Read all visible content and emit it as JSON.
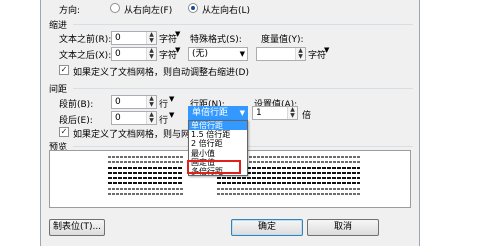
{
  "direction": {
    "label": "方向:",
    "left_to_right": "从右向左(F)",
    "right_to_left": "从左向右(L)"
  },
  "indent": {
    "section_title": "缩进",
    "before_label": "文本之前(R):",
    "before_value": "0",
    "before_unit": "字符",
    "after_label": "文本之后(X):",
    "after_value": "0",
    "after_unit": "字符",
    "special_label": "特殊格式(S):",
    "special_value": "(无)",
    "measure_label": "度量值(Y):",
    "measure_value": "",
    "measure_unit": "字符",
    "grid_checkbox": "如果定义了文档网格，则自动调整右缩进(D)"
  },
  "spacing": {
    "section_title": "间距",
    "before_label": "段前(B):",
    "before_value": "0",
    "before_unit": "行",
    "after_label": "段后(E):",
    "after_value": "0",
    "after_unit": "行",
    "line_label": "行距(N):",
    "line_value": "单倍行距",
    "setting_label": "设置值(A):",
    "setting_value": "1",
    "setting_unit": "倍",
    "grid_checkbox": "如果定义了文档网格，则与网格对",
    "options": [
      "单倍行距",
      "1.5 倍行距",
      "2 倍行距",
      "最小值",
      "固定值",
      "多倍行距"
    ]
  },
  "preview": {
    "section_title": "预览"
  },
  "buttons": {
    "tabs": "制表位(T)...",
    "ok": "确定",
    "cancel": "取消"
  },
  "colors": {
    "highlight": "#3399ff",
    "annotation": "#e0201b"
  }
}
